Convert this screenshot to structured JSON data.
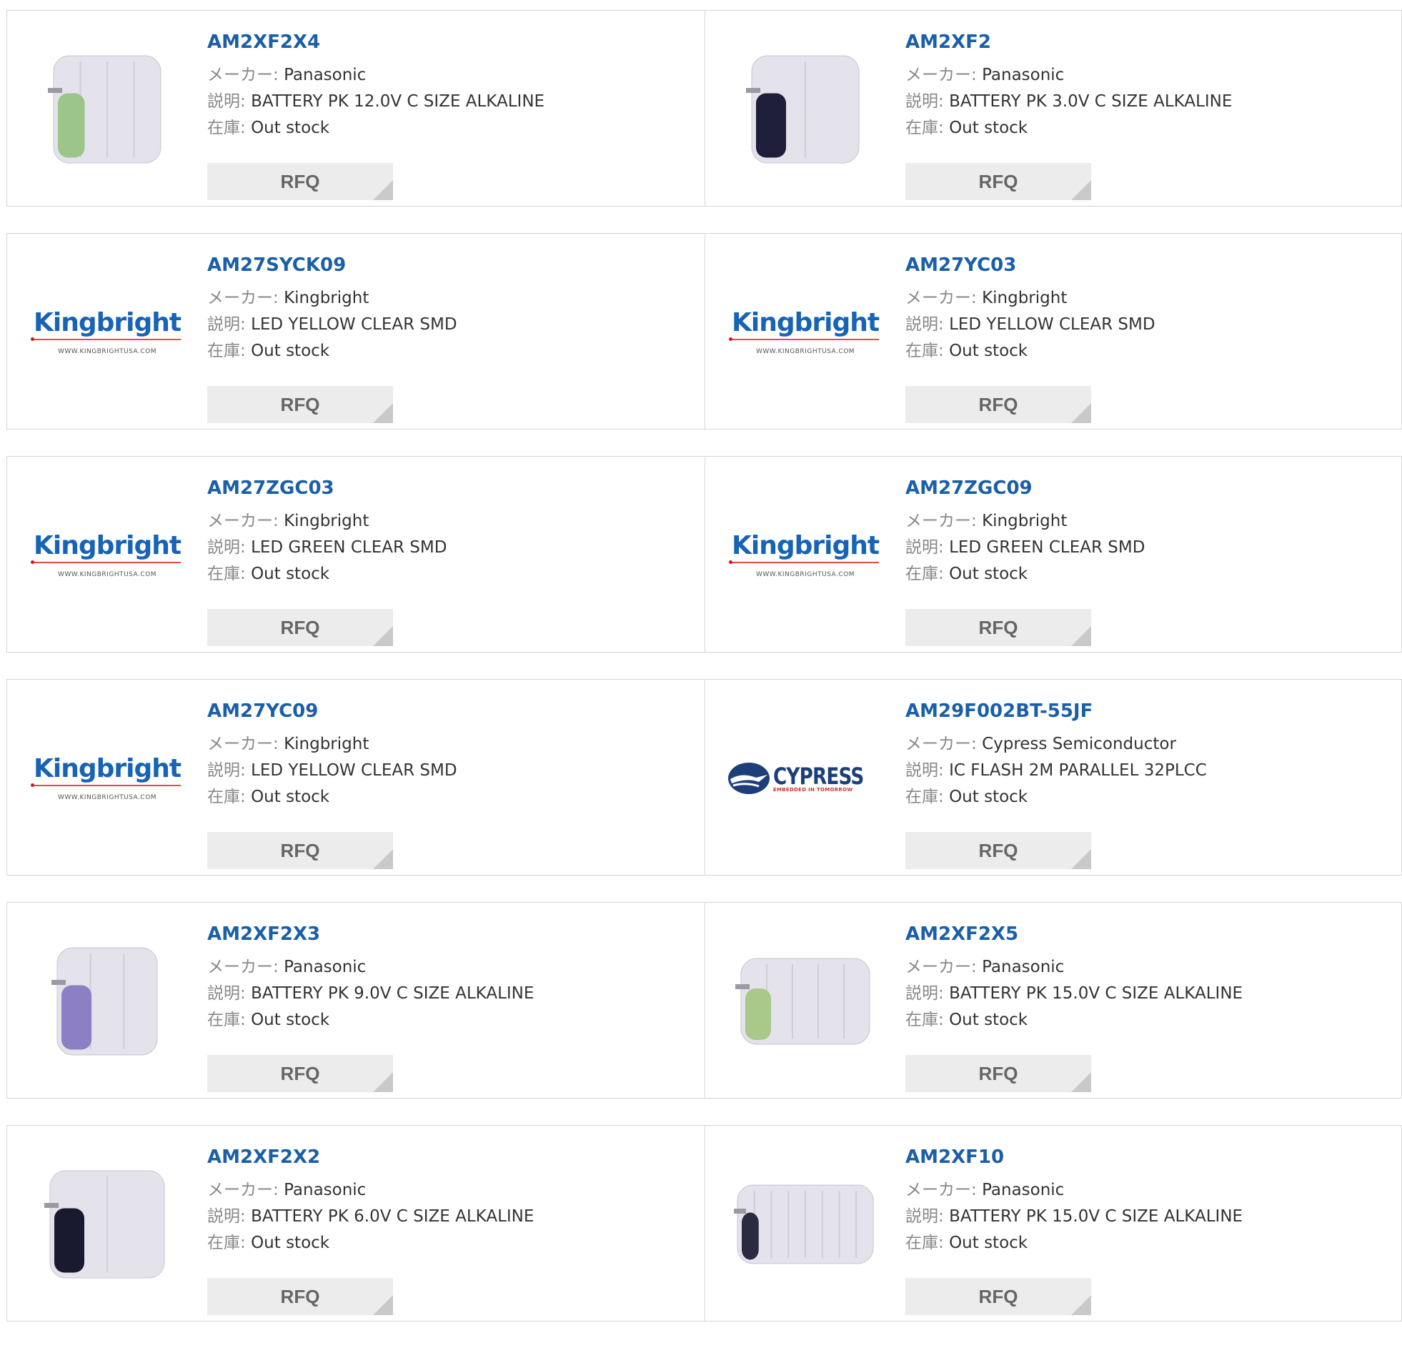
{
  "labels": {
    "maker": "メーカー:",
    "desc": "説明:",
    "stock": "在庫:",
    "rfq": "RFQ"
  },
  "kingbright_logo": {
    "name": "Kingbright",
    "url": "WWW.KINGBRIGHTUSA.COM"
  },
  "cypress_logo": {
    "name": "CYPRESS",
    "tagline": "EMBEDDED IN TOMORROW"
  },
  "products": [
    {
      "part": "AM2XF2X4",
      "maker": "Panasonic",
      "desc": "BATTERY PK 12.0V C SIZE ALKALINE",
      "stock": "Out stock",
      "image": "battery-pack-4cell-green"
    },
    {
      "part": "AM2XF2",
      "maker": "Panasonic",
      "desc": "BATTERY PK 3.0V C SIZE ALKALINE",
      "stock": "Out stock",
      "image": "battery-pack-2cell-dark"
    },
    {
      "part": "AM27SYCK09",
      "maker": "Kingbright",
      "desc": "LED YELLOW CLEAR SMD",
      "stock": "Out stock",
      "image": "kingbright-logo"
    },
    {
      "part": "AM27YC03",
      "maker": "Kingbright",
      "desc": "LED YELLOW CLEAR SMD",
      "stock": "Out stock",
      "image": "kingbright-logo"
    },
    {
      "part": "AM27ZGC03",
      "maker": "Kingbright",
      "desc": "LED GREEN CLEAR SMD",
      "stock": "Out stock",
      "image": "kingbright-logo"
    },
    {
      "part": "AM27ZGC09",
      "maker": "Kingbright",
      "desc": "LED GREEN CLEAR SMD",
      "stock": "Out stock",
      "image": "kingbright-logo"
    },
    {
      "part": "AM27YC09",
      "maker": "Kingbright",
      "desc": "LED YELLOW CLEAR SMD",
      "stock": "Out stock",
      "image": "kingbright-logo"
    },
    {
      "part": "AM29F002BT-55JF",
      "maker": "Cypress Semiconductor",
      "desc": "IC FLASH 2M PARALLEL 32PLCC",
      "stock": "Out stock",
      "image": "cypress-logo"
    },
    {
      "part": "AM2XF2X3",
      "maker": "Panasonic",
      "desc": "BATTERY PK 9.0V C SIZE ALKALINE",
      "stock": "Out stock",
      "image": "battery-pack-3cell-purple"
    },
    {
      "part": "AM2XF2X5",
      "maker": "Panasonic",
      "desc": "BATTERY PK 15.0V C SIZE ALKALINE",
      "stock": "Out stock",
      "image": "battery-pack-5cell-green"
    },
    {
      "part": "AM2XF2X2",
      "maker": "Panasonic",
      "desc": "BATTERY PK 6.0V C SIZE ALKALINE",
      "stock": "Out stock",
      "image": "battery-pack-2cell-black"
    },
    {
      "part": "AM2XF10",
      "maker": "Panasonic",
      "desc": "BATTERY PK 15.0V C SIZE ALKALINE",
      "stock": "Out stock",
      "image": "battery-pack-10cell-white"
    }
  ],
  "colors": {
    "part_link": "#1a5fa8",
    "rfq_bg": "#ececec",
    "border": "#d6d6d6",
    "kingbright_blue": "#1763b6",
    "cypress_navy": "#1c3f7a"
  }
}
